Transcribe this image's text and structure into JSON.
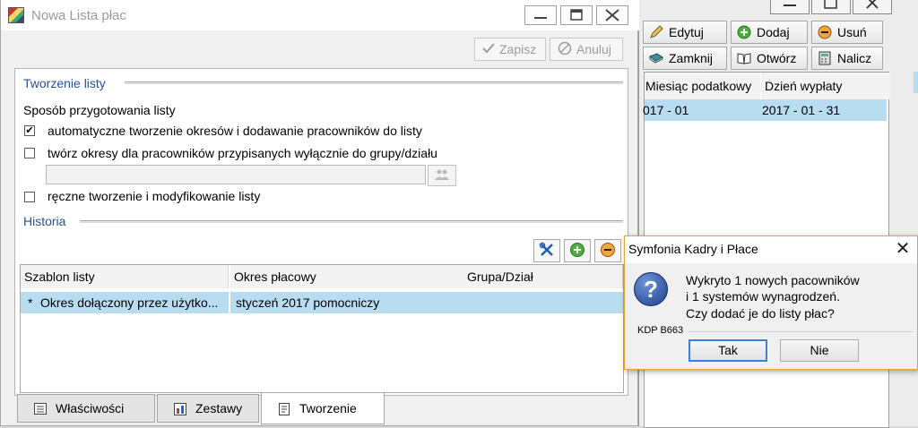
{
  "background_window": {
    "toolbar": {
      "edit_label": "Edytuj",
      "add_label": "Dodaj",
      "delete_label": "Usuń",
      "close_label": "Zamknij",
      "open_label": "Otwórz",
      "calc_label": "Nalicz"
    },
    "grid": {
      "columns": [
        "Miesiąc podatkowy",
        "Dzień wypłaty"
      ],
      "rows": [
        [
          "017 - 01",
          "2017 - 01 - 31"
        ]
      ]
    }
  },
  "main_window": {
    "title": "Nowa Lista płac",
    "toolbar": {
      "save_label": "Zapisz",
      "cancel_label": "Anuluj"
    },
    "creation_section": {
      "title": "Tworzenie listy",
      "method_label": "Sposób przygotowania listy",
      "options": [
        {
          "label": "automatyczne tworzenie okresów i dodawanie pracowników do listy",
          "checked": true
        },
        {
          "label": "twórz okresy dla pracowników przypisanych wyłącznie do grupy/działu",
          "checked": false
        },
        {
          "label": "ręczne tworzenie i modyfikowanie listy",
          "checked": false
        }
      ],
      "group_value": ""
    },
    "history_section": {
      "title": "Historia",
      "columns": [
        "Szablon listy",
        "Okres płacowy",
        "Grupa/Dział"
      ],
      "rows": [
        {
          "marker": "*",
          "template": "Okres dołączony przez użytko...",
          "period": "styczeń 2017 pomocniczy",
          "group": ""
        }
      ]
    },
    "tabs": [
      {
        "label": "Właściwości",
        "active": false
      },
      {
        "label": "Zestawy",
        "active": false
      },
      {
        "label": "Tworzenie",
        "active": true
      }
    ]
  },
  "dialog": {
    "title": "Symfonia Kadry i Płace",
    "message_lines": [
      "Wykryto 1 nowych pacowników",
      "i 1 systemów wynagrodzeń.",
      "Czy dodać je do listy płac?"
    ],
    "code": "KDP B663",
    "yes_label": "Tak",
    "no_label": "Nie"
  },
  "colors": {
    "selection": "#b8dcf0",
    "section_title": "#2a4f9a",
    "dialog_border": "#e8a23a"
  }
}
